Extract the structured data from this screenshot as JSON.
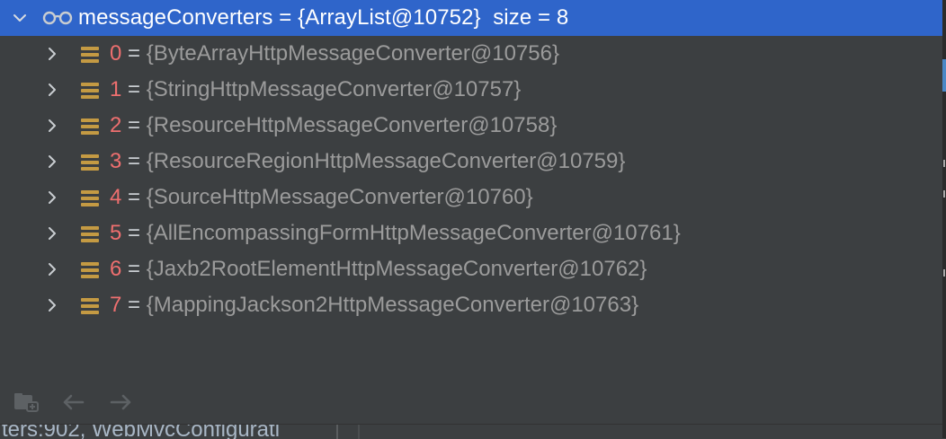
{
  "variable": {
    "name": "messageConverters",
    "value": "= {ArrayList@10752}",
    "size_text": "size = 8"
  },
  "items": [
    {
      "index": "0",
      "eq": "=",
      "value": "{ByteArrayHttpMessageConverter@10756}"
    },
    {
      "index": "1",
      "eq": "=",
      "value": "{StringHttpMessageConverter@10757}"
    },
    {
      "index": "2",
      "eq": "=",
      "value": "{ResourceHttpMessageConverter@10758}"
    },
    {
      "index": "3",
      "eq": "=",
      "value": "{ResourceRegionHttpMessageConverter@10759}"
    },
    {
      "index": "4",
      "eq": "=",
      "value": "{SourceHttpMessageConverter@10760}"
    },
    {
      "index": "5",
      "eq": "=",
      "value": "{AllEncompassingFormHttpMessageConverter@10761}"
    },
    {
      "index": "6",
      "eq": "=",
      "value": "{Jaxb2RootElementHttpMessageConverter@10762}"
    },
    {
      "index": "7",
      "eq": "=",
      "value": "{MappingJackson2HttpMessageConverter@10763}"
    }
  ],
  "frames": {
    "current_frame": "ters:902, WebMvcConfigurati"
  },
  "icons": {
    "expand": "chevron-down-icon",
    "collapse": "chevron-right-icon",
    "watch": "glasses-icon",
    "field": "field-icon",
    "frames": "frames-icon",
    "back": "arrow-left-icon",
    "forward": "arrow-right-icon"
  },
  "colors": {
    "background": "#3c3f41",
    "selection": "#2f65ca",
    "index": "#ee6f6f",
    "value": "#9b9b9b",
    "field_icon": "#c49a43"
  }
}
